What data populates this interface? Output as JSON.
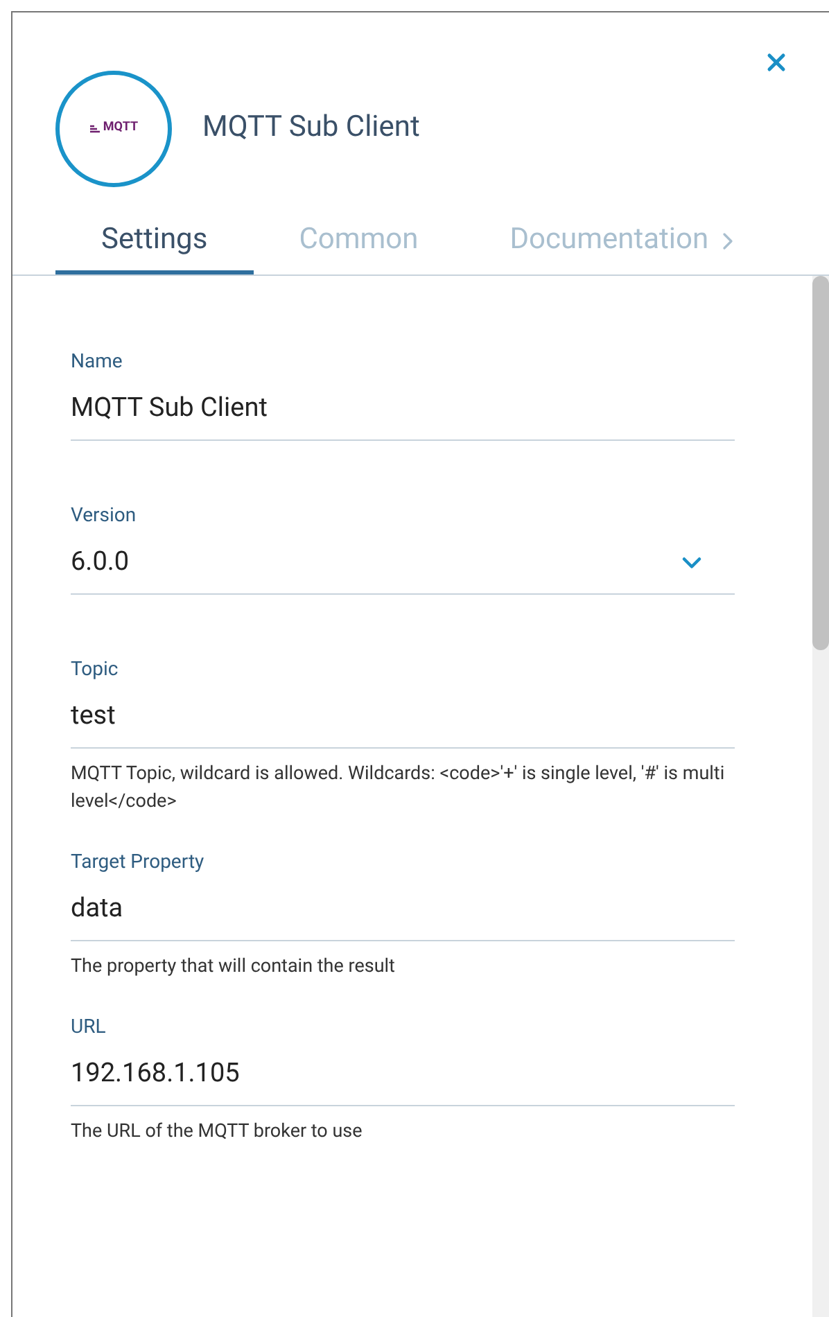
{
  "header": {
    "logo_text": "MQTT",
    "title": "MQTT Sub Client"
  },
  "tabs": [
    {
      "label": "Settings",
      "selected": true
    },
    {
      "label": "Common",
      "selected": false
    },
    {
      "label": "Documentation",
      "selected": false
    }
  ],
  "fields": [
    {
      "kind": "text",
      "label": "Name",
      "value": "MQTT Sub Client"
    },
    {
      "kind": "select",
      "label": "Version",
      "value": "6.0.0"
    },
    {
      "kind": "text",
      "label": "Topic",
      "value": "test",
      "help": "MQTT Topic, wildcard is allowed. Wildcards: <code>'+' is single level, '#' is multi level</code>"
    },
    {
      "kind": "text",
      "label": "Target Property",
      "value": "data",
      "help": "The property that will contain the result"
    },
    {
      "kind": "text",
      "label": "URL",
      "value": "192.168.1.105",
      "help": "The URL of the MQTT broker to use"
    }
  ]
}
